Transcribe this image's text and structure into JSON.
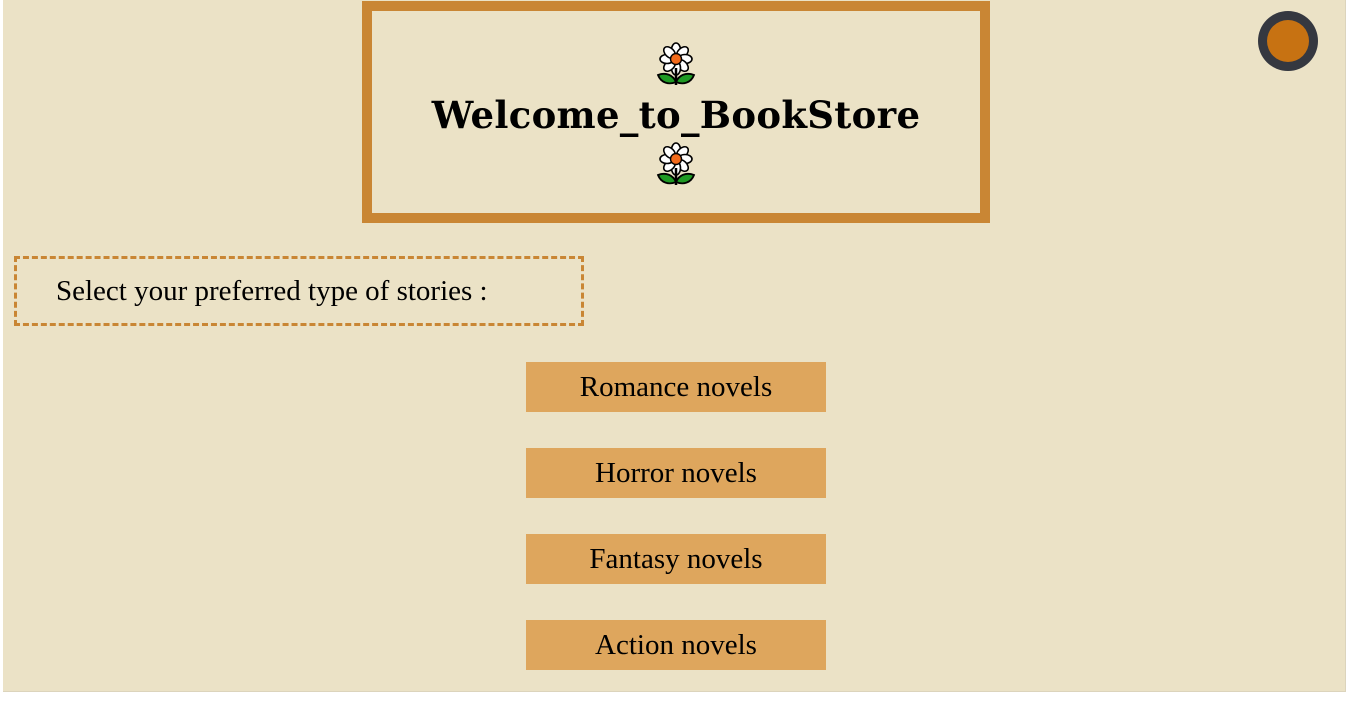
{
  "header": {
    "title": "Welcome_to_BookStore",
    "decoration_icon": "daisy-flower-icon"
  },
  "prompt": {
    "text": "Select your preferred type of stories :"
  },
  "genres": [
    {
      "label": "Romance novels"
    },
    {
      "label": "Horror novels"
    },
    {
      "label": "Fantasy novels"
    },
    {
      "label": "Action novels"
    }
  ],
  "theme_toggle": {
    "icon": "theme-toggle-icon"
  },
  "colors": {
    "background": "#ebe2c6",
    "frame": "#c98634",
    "button": "#dea65d",
    "toggle_ring": "#353840",
    "toggle_fill": "#c77212"
  }
}
